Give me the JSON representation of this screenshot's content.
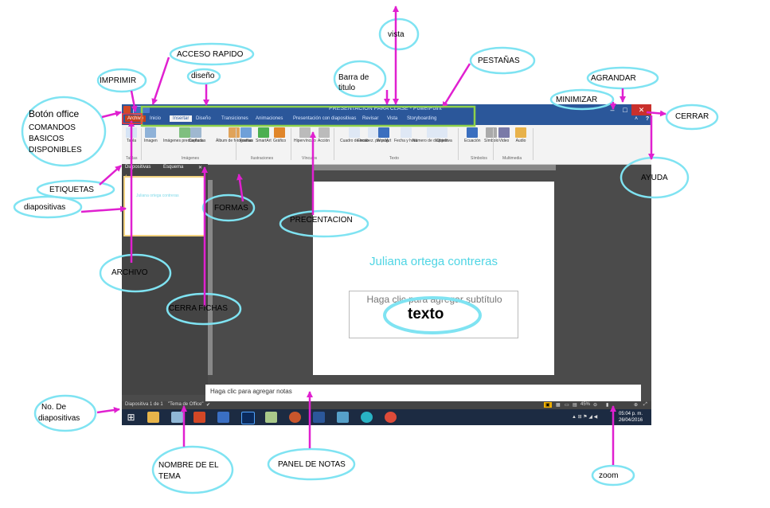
{
  "app": {
    "title_text": "PRESENTACION PARA CLASE - PowerPoint",
    "tabs": [
      "Archivo",
      "Inicio",
      "Insertar",
      "Diseño",
      "Transiciones",
      "Animaciones",
      "Presentación con diapositivas",
      "Revisar",
      "Vista",
      "Storyboarding"
    ],
    "active_tab_index": 2,
    "ribbon": {
      "buttons": [
        {
          "label": "Tabla",
          "icon": "table-icon"
        },
        {
          "label": "Imagen",
          "icon": "picture-icon"
        },
        {
          "label": "Imágenes prediseñadas",
          "icon": "clipart-icon"
        },
        {
          "label": "Captura",
          "icon": "screenshot-icon"
        },
        {
          "label": "Álbum de fotografías",
          "icon": "photo-album-icon"
        },
        {
          "label": "Formas",
          "icon": "shapes-icon"
        },
        {
          "label": "SmartArt",
          "icon": "smartart-icon"
        },
        {
          "label": "Gráfico",
          "icon": "chart-icon"
        },
        {
          "label": "Hipervínculo",
          "icon": "hyperlink-icon"
        },
        {
          "label": "Acción",
          "icon": "action-icon"
        },
        {
          "label": "Cuadro de texto",
          "icon": "textbox-icon"
        },
        {
          "label": "Encabez. pie pág.",
          "icon": "header-footer-icon"
        },
        {
          "label": "WordArt",
          "icon": "wordart-icon"
        },
        {
          "label": "Fecha y hora",
          "icon": "date-time-icon"
        },
        {
          "label": "Número de diapositiva",
          "icon": "slide-number-icon"
        },
        {
          "label": "Objeto",
          "icon": "object-icon"
        },
        {
          "label": "Ecuación",
          "icon": "equation-icon"
        },
        {
          "label": "Símbolo",
          "icon": "symbol-icon"
        },
        {
          "label": "Video",
          "icon": "video-icon"
        },
        {
          "label": "Audio",
          "icon": "audio-icon"
        }
      ],
      "groups": [
        "Tablas",
        "Imágenes",
        "Ilustraciones",
        "Vínculos",
        "Texto",
        "Símbolos",
        "Multimedia"
      ]
    },
    "panel_tabs": [
      "Diapositivas",
      "Esquema"
    ],
    "thumb_number": "1",
    "thumb_text": "Juliana ortega contreras",
    "slide_title": "Juliana ortega contreras",
    "slide_subtitle_placeholder": "Haga clic para agregar subtítulo",
    "notes_placeholder": "Haga clic para agregar notas",
    "status_slide": "Diapositiva 1 de 1",
    "status_theme": "\"Tema de Office\"",
    "status_zoom": "45%",
    "clock_time": "05:04 p. m.",
    "clock_date": "26/04/2016"
  },
  "annotations": {
    "color": "#e020d0",
    "ellipse_color": "#7fe3f2",
    "texto_label": "texto",
    "labels": {
      "acceso_rapido": "ACCESO RAPIDO",
      "imprimir": "IMPRIMIR",
      "diseno": "diseño",
      "vista": "vista",
      "pestanas": "PESTAÑAS",
      "barra_titulo_1": "Barra de",
      "barra_titulo_2": "titulo",
      "agrandar": "AGRANDAR",
      "minimizar": "MINIMIZAR",
      "cerrar": "CERRAR",
      "boton_office_1": "Botón office",
      "boton_office_2": "COMANDOS",
      "boton_office_3": "BASICOS",
      "boton_office_4": "DISPONIBLES",
      "etiquetas": "ETIQUETAS",
      "diapositivas": "diapositivas",
      "formas": "FORMAS",
      "precentacion": "PRECENTACION",
      "ayuda": "AYUDA",
      "archivo": "ARCHIVO",
      "cerra_fichas": "CERRA FICHAS",
      "no_diapositivas_1": "No. De",
      "no_diapositivas_2": "diapositivas",
      "nombre_tema_1": "NOMBRE DE EL",
      "nombre_tema_2": "TEMA",
      "panel_notas": "PANEL DE NOTAS",
      "zoom": "zoom"
    }
  }
}
